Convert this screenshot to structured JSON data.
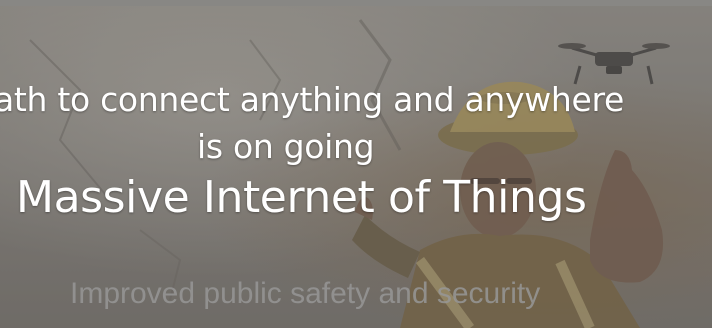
{
  "slide": {
    "headline_line_1": "ath to connect anything and anywhere",
    "headline_line_2": "is on going",
    "title": "Massive Internet of Things",
    "subtitle": "Improved public safety and security"
  },
  "colors": {
    "text": "#ffffff",
    "subtitle_text": "#969696",
    "overlay": "#7b7873"
  }
}
